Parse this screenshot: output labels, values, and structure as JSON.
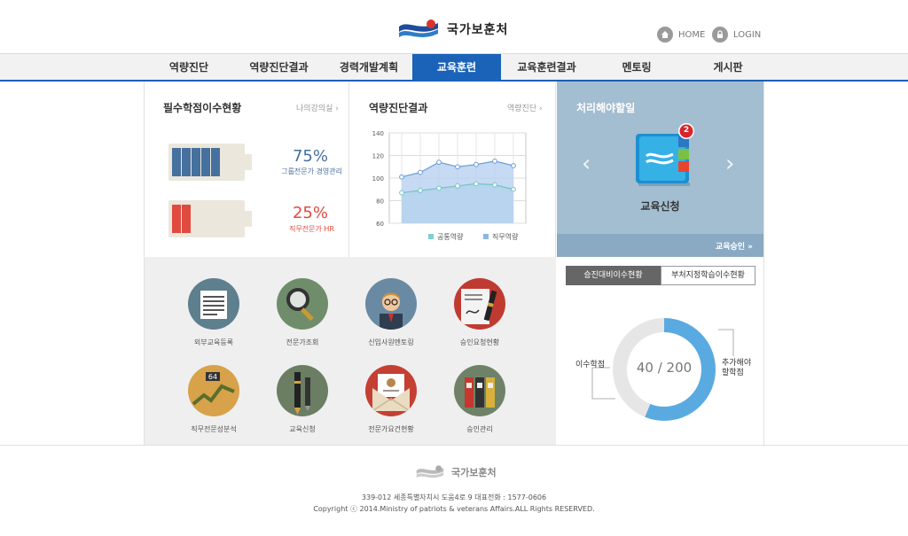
{
  "header": {
    "org_name": "국가보훈처",
    "home_label": "HOME",
    "login_label": "LOGIN"
  },
  "nav": {
    "items": [
      {
        "label": "역량진단"
      },
      {
        "label": "역량진단결과"
      },
      {
        "label": "경력개발계획"
      },
      {
        "label": "교육훈련",
        "active": true
      },
      {
        "label": "교육훈련결과"
      },
      {
        "label": "멘토링"
      },
      {
        "label": "게시판"
      }
    ]
  },
  "credits": {
    "title": "필수학점이수현황",
    "link": "나의강의실",
    "group": {
      "percent": "75%",
      "label": "그룹전문가 경영관리",
      "filled": 5,
      "total": 5,
      "color": "#46709e"
    },
    "job": {
      "percent": "25%",
      "label": "직무전문가 HR",
      "filled": 2,
      "total": 2,
      "color": "#e04a3f"
    }
  },
  "diagnosis": {
    "title": "역량진단결과",
    "link": "역량진단"
  },
  "chart_data": {
    "type": "area",
    "x": [
      1,
      2,
      3,
      4,
      5,
      6,
      7
    ],
    "ylim": [
      60,
      140
    ],
    "yticks": [
      "140",
      "120",
      "100",
      "80",
      "60"
    ],
    "grid": true,
    "legend": "bottom-right",
    "series": [
      {
        "name": "공통역량",
        "values": [
          87,
          89,
          91,
          93,
          95,
          94,
          90
        ],
        "color": "#7fd0cf"
      },
      {
        "name": "직무역량",
        "values": [
          101,
          105,
          114,
          110,
          112,
          115,
          111
        ],
        "color": "#8fb5e5"
      }
    ]
  },
  "todo": {
    "title": "처리해야할일",
    "badge": "2",
    "item": "교육신청",
    "approve_link": "교육승인 »"
  },
  "menu": {
    "items": [
      {
        "label": "외부교육등록",
        "icon": "document-icon"
      },
      {
        "label": "전문가조회",
        "icon": "magnifier-icon"
      },
      {
        "label": "신입사원멘토링",
        "icon": "person-icon"
      },
      {
        "label": "승인요청현황",
        "icon": "pen-icon"
      },
      {
        "label": "직무전문성분석",
        "icon": "growth-chart-icon"
      },
      {
        "label": "교육신청",
        "icon": "fountain-pen-icon"
      },
      {
        "label": "전문가요건현황",
        "icon": "envelope-icon"
      },
      {
        "label": "승인관리",
        "icon": "binders-icon"
      }
    ]
  },
  "progress": {
    "tab_active": "승진대비이수현황",
    "tab_inactive": "부처지정학습이수현황",
    "value": "40 / 200",
    "fraction": 0.2,
    "left_label": "이수학점",
    "right_label_1": "추가해야",
    "right_label_2": "할학점",
    "done_color": "#e6e6e6",
    "remain_color": "#5aaae2"
  },
  "footer": {
    "org_name": "국가보훈처",
    "address": "339-012 세종특별자치시 도움4로 9 대표전화 : 1577-0606",
    "copyright": "Copyright ⓒ 2014.Ministry of patriots & veterans Affairs.ALL Rights RESERVED."
  }
}
